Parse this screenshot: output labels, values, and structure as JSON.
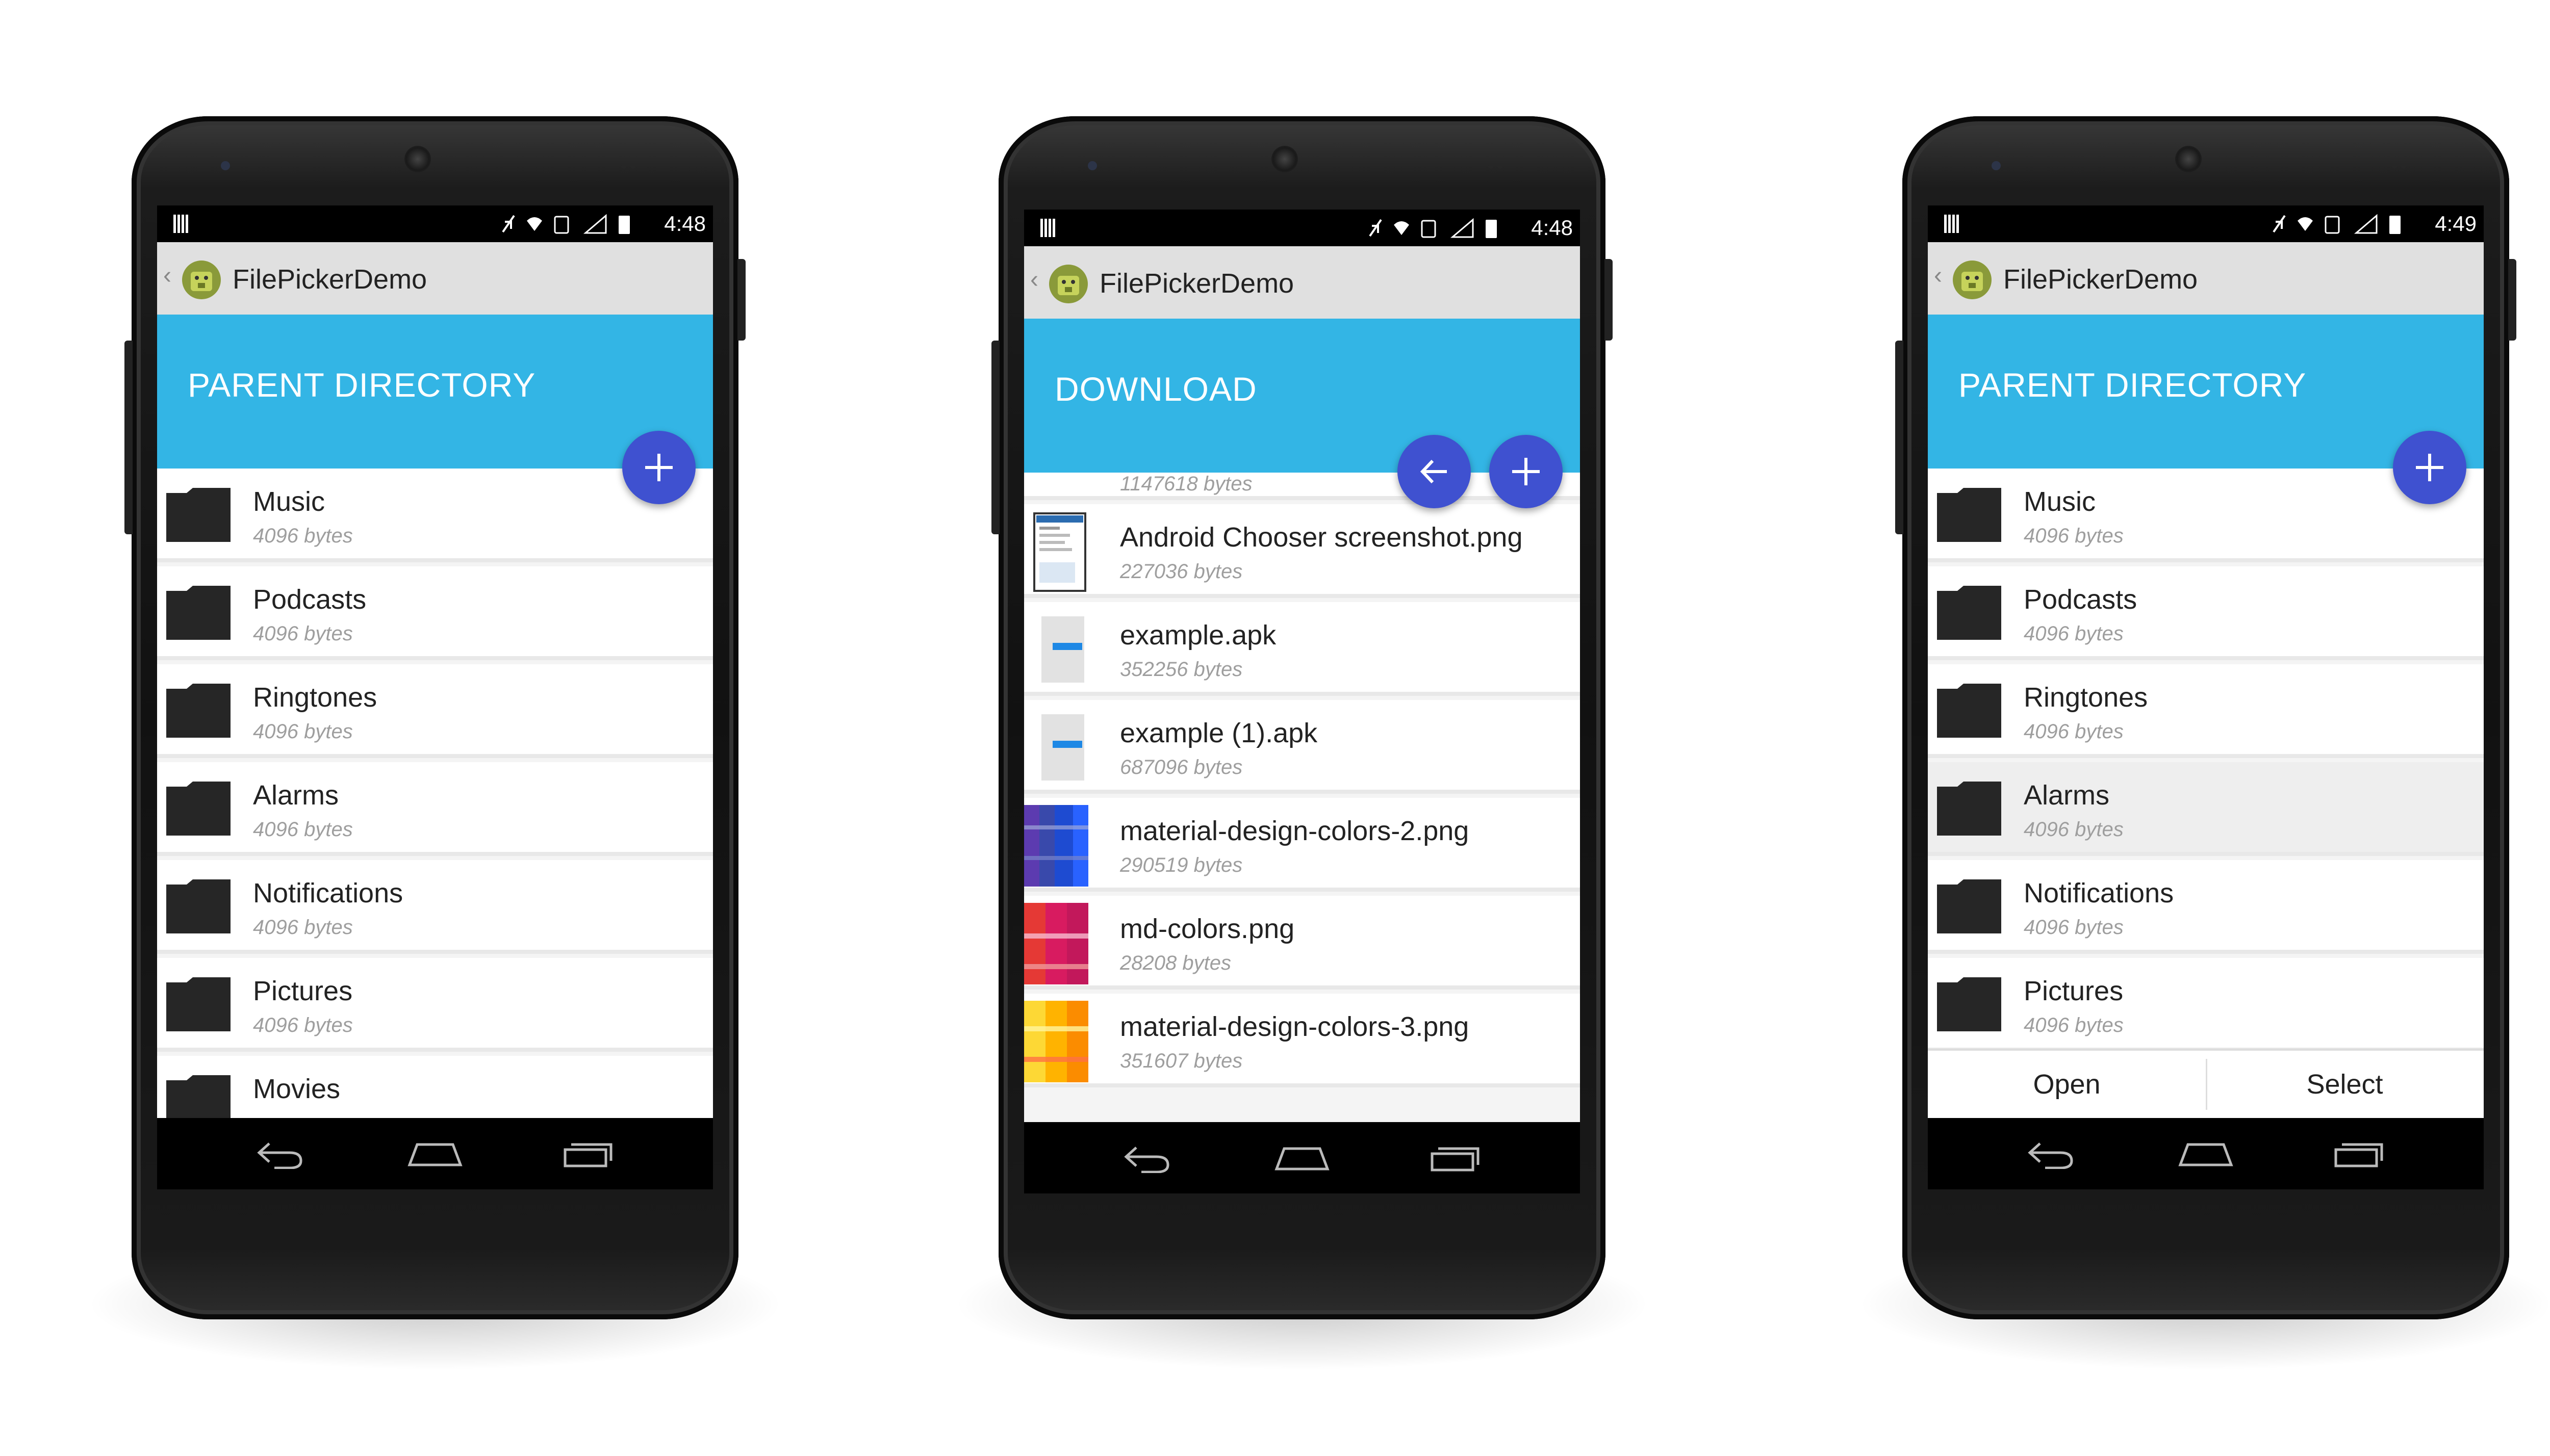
{
  "app_title": "FilePickerDemo",
  "colors": {
    "header": "#33b5e5",
    "fab": "#3f51d0",
    "action_bar": "#e0e0e0"
  },
  "phones": [
    {
      "time": "4:48",
      "header": "PARENT DIRECTORY",
      "fab_icons": [
        "plus-icon"
      ],
      "items": [
        {
          "name": "Music",
          "size": "4096 bytes"
        },
        {
          "name": "Podcasts",
          "size": "4096 bytes"
        },
        {
          "name": "Ringtones",
          "size": "4096 bytes"
        },
        {
          "name": "Alarms",
          "size": "4096 bytes"
        },
        {
          "name": "Notifications",
          "size": "4096 bytes"
        },
        {
          "name": "Pictures",
          "size": "4096 bytes"
        },
        {
          "name": "Movies",
          "size": ""
        }
      ]
    },
    {
      "time": "4:48",
      "header": "DOWNLOAD",
      "fab_icons": [
        "back-arrow-icon",
        "plus-icon"
      ],
      "partial_size": "1147618 bytes",
      "items": [
        {
          "name": "Android Chooser screenshot.png",
          "size": "227036 bytes"
        },
        {
          "name": "example.apk",
          "size": "352256 bytes"
        },
        {
          "name": "example (1).apk",
          "size": "687096 bytes"
        },
        {
          "name": "material-design-colors-2.png",
          "size": "290519 bytes"
        },
        {
          "name": "md-colors.png",
          "size": "28208 bytes"
        },
        {
          "name": "material-design-colors-3.png",
          "size": "351607 bytes"
        }
      ]
    },
    {
      "time": "4:49",
      "header": "PARENT DIRECTORY",
      "fab_icons": [
        "plus-icon"
      ],
      "selected": "Alarms",
      "items": [
        {
          "name": "Music",
          "size": "4096 bytes"
        },
        {
          "name": "Podcasts",
          "size": "4096 bytes"
        },
        {
          "name": "Ringtones",
          "size": "4096 bytes"
        },
        {
          "name": "Alarms",
          "size": "4096 bytes"
        },
        {
          "name": "Notifications",
          "size": "4096 bytes"
        },
        {
          "name": "Pictures",
          "size": "4096 bytes"
        }
      ],
      "actions": {
        "open": "Open",
        "select": "Select"
      }
    }
  ]
}
